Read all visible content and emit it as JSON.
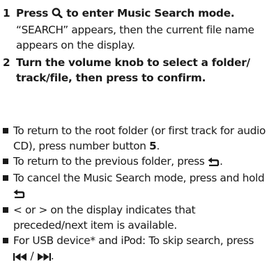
{
  "steps": [
    {
      "num": "1",
      "title_before": "Press",
      "title_icon": "search-icon",
      "title_after": "to enter Music Search mode.",
      "desc": "“SEARCH” appears, then the current file name appears on the display."
    },
    {
      "num": "2",
      "title": "Turn the volume knob to select a folder/ track/file, then press to confirm."
    }
  ],
  "bullets": [
    {
      "text_before": "To return to the root folder (or first track for audio CD), press number button",
      "number": "5",
      "text_after": "."
    },
    {
      "text_before": "To return to the previous folder, press",
      "icon": "back-icon",
      "text_after": "."
    },
    {
      "text_before": "To cancel the Music Search mode, press and hold",
      "icon": "back-icon"
    },
    {
      "text": "< or > on the display indicates that preceded/next item is available."
    },
    {
      "text_before": "For USB device* and iPod: To skip search, press",
      "icon_prev": "previous-track-icon",
      "separator": "/",
      "icon_next": "next-track-icon",
      "text_after": "."
    }
  ]
}
